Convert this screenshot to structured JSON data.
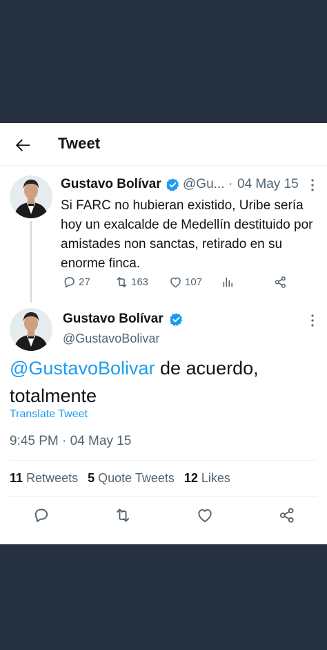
{
  "header": {
    "title": "Tweet"
  },
  "parent_tweet": {
    "author_name": "Gustavo Bolívar",
    "handle": "@Gu...",
    "separator": "·",
    "date": "04 May 15",
    "text": "Si FARC no hubieran existido, Uribe sería hoy un exalcalde de Medellín destituido por amistades non sanctas, retirado en su enorme finca.",
    "replies": "27",
    "retweets": "163",
    "likes": "107"
  },
  "main_tweet": {
    "author_name": "Gustavo Bolívar",
    "handle": "@GustavoBolivar",
    "mention": "@GustavoBolivar",
    "text": " de acuerdo, totalmente",
    "translate_label": "Translate Tweet",
    "timestamp": "9:45 PM · 04 May 15",
    "retweets_count": "11",
    "retweets_label": "Retweets",
    "quotes_count": "5",
    "quotes_label": "Quote Tweets",
    "likes_count": "12",
    "likes_label": "Likes"
  },
  "colors": {
    "accent": "#1d9bf0",
    "muted": "#536471",
    "backdrop": "#253140"
  },
  "icons": [
    "back-arrow-icon",
    "verified-badge-icon",
    "more-icon",
    "reply-icon",
    "retweet-icon",
    "like-icon",
    "analytics-icon",
    "share-icon"
  ]
}
